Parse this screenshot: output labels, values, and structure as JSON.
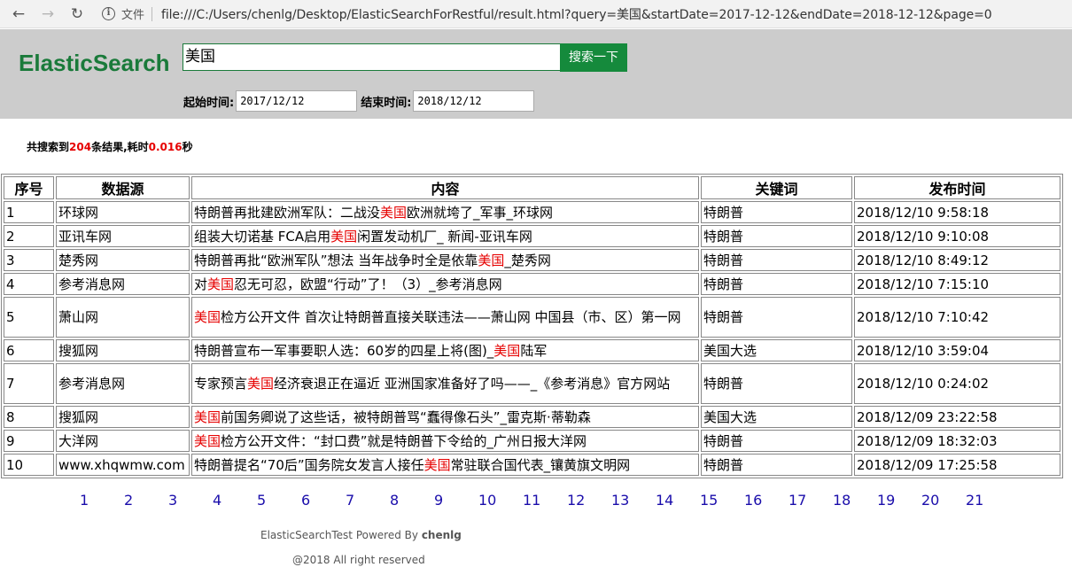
{
  "browser": {
    "back_icon": "←",
    "forward_icon": "→",
    "reload_icon": "↻",
    "info_icon": "i",
    "file_label": "文件",
    "url": "file:///C:/Users/chenlg/Desktop/ElasticSearchForRestful/result.html?query=美国&startDate=2017-12-12&endDate=2018-12-12&page=0"
  },
  "header": {
    "logo": "ElasticSearch",
    "search_value": "美国",
    "search_button": "搜索一下",
    "start_label": "起始时间:",
    "start_value": "2017/12/12",
    "end_label": "结束时间:",
    "end_value": "2018/12/12"
  },
  "summary": {
    "prefix": "共搜索到",
    "count": "204",
    "middle": "条结果,耗时",
    "time": "0.016",
    "suffix": "秒"
  },
  "table": {
    "headers": [
      "序号",
      "数据源",
      "内容",
      "关键词",
      "发布时间"
    ],
    "highlight_color": "#e60000",
    "rows": [
      {
        "no": "1",
        "source": "环球网",
        "before": "特朗普再批建欧洲军队：二战没",
        "hl": "美国",
        "after": "欧洲就垮了_军事_环球网",
        "keyword": "特朗普",
        "time": "2018/12/10 9:58:18"
      },
      {
        "no": "2",
        "source": "亚讯车网",
        "before": "组装大切诺基 FCA启用",
        "hl": "美国",
        "after": "闲置发动机厂_ 新闻-亚讯车网",
        "keyword": "特朗普",
        "time": "2018/12/10 9:10:08"
      },
      {
        "no": "3",
        "source": "楚秀网",
        "before": "特朗普再批“欧洲军队”想法 当年战争时全是依靠",
        "hl": "美国",
        "after": "_楚秀网",
        "keyword": "特朗普",
        "time": "2018/12/10 8:49:12"
      },
      {
        "no": "4",
        "source": "参考消息网",
        "before": "对",
        "hl": "美国",
        "after": "忍无可忍，欧盟“行动”了！（3）_参考消息网",
        "keyword": "特朗普",
        "time": "2018/12/10 7:15:10"
      },
      {
        "no": "5",
        "source": "萧山网",
        "before": "",
        "hl": "美国",
        "after": "检方公开文件 首次让特朗普直接关联违法——萧山网 中国县（市、区）第一网",
        "keyword": "特朗普",
        "time": "2018/12/10 7:10:42"
      },
      {
        "no": "6",
        "source": "搜狐网",
        "before": "特朗普宣布一军事要职人选：60岁的四星上将(图)_",
        "hl": "美国",
        "after": "陆军",
        "keyword": "美国大选",
        "time": "2018/12/10 3:59:04"
      },
      {
        "no": "7",
        "source": "参考消息网",
        "before": "专家预言",
        "hl": "美国",
        "after": "经济衰退正在逼近 亚洲国家准备好了吗——_《参考消息》官方网站",
        "keyword": "特朗普",
        "time": "2018/12/10 0:24:02"
      },
      {
        "no": "8",
        "source": "搜狐网",
        "before": "",
        "hl": "美国",
        "after": "前国务卿说了这些话，被特朗普骂“蠢得像石头”_雷克斯·蒂勒森",
        "keyword": "美国大选",
        "time": "2018/12/09 23:22:58"
      },
      {
        "no": "9",
        "source": "大洋网",
        "before": "",
        "hl": "美国",
        "after": "检方公开文件：“封口费”就是特朗普下令给的_广州日报大洋网",
        "keyword": "特朗普",
        "time": "2018/12/09 18:32:03"
      },
      {
        "no": "10",
        "source": "www.xhqwmw.com",
        "before": "特朗普提名“70后”国务院女发言人接任",
        "hl": "美国",
        "after": "常驻联合国代表_镶黄旗文明网",
        "keyword": "特朗普",
        "time": "2018/12/09 17:25:58"
      }
    ]
  },
  "pagination": [
    "1",
    "2",
    "3",
    "4",
    "5",
    "6",
    "7",
    "8",
    "9",
    "10",
    "11",
    "12",
    "13",
    "14",
    "15",
    "16",
    "17",
    "18",
    "19",
    "20",
    "21"
  ],
  "footer": {
    "powered_prefix": "ElasticSearchTest Powered By ",
    "powered_name": "chenlg",
    "copyright": "@2018 All right reserved"
  }
}
